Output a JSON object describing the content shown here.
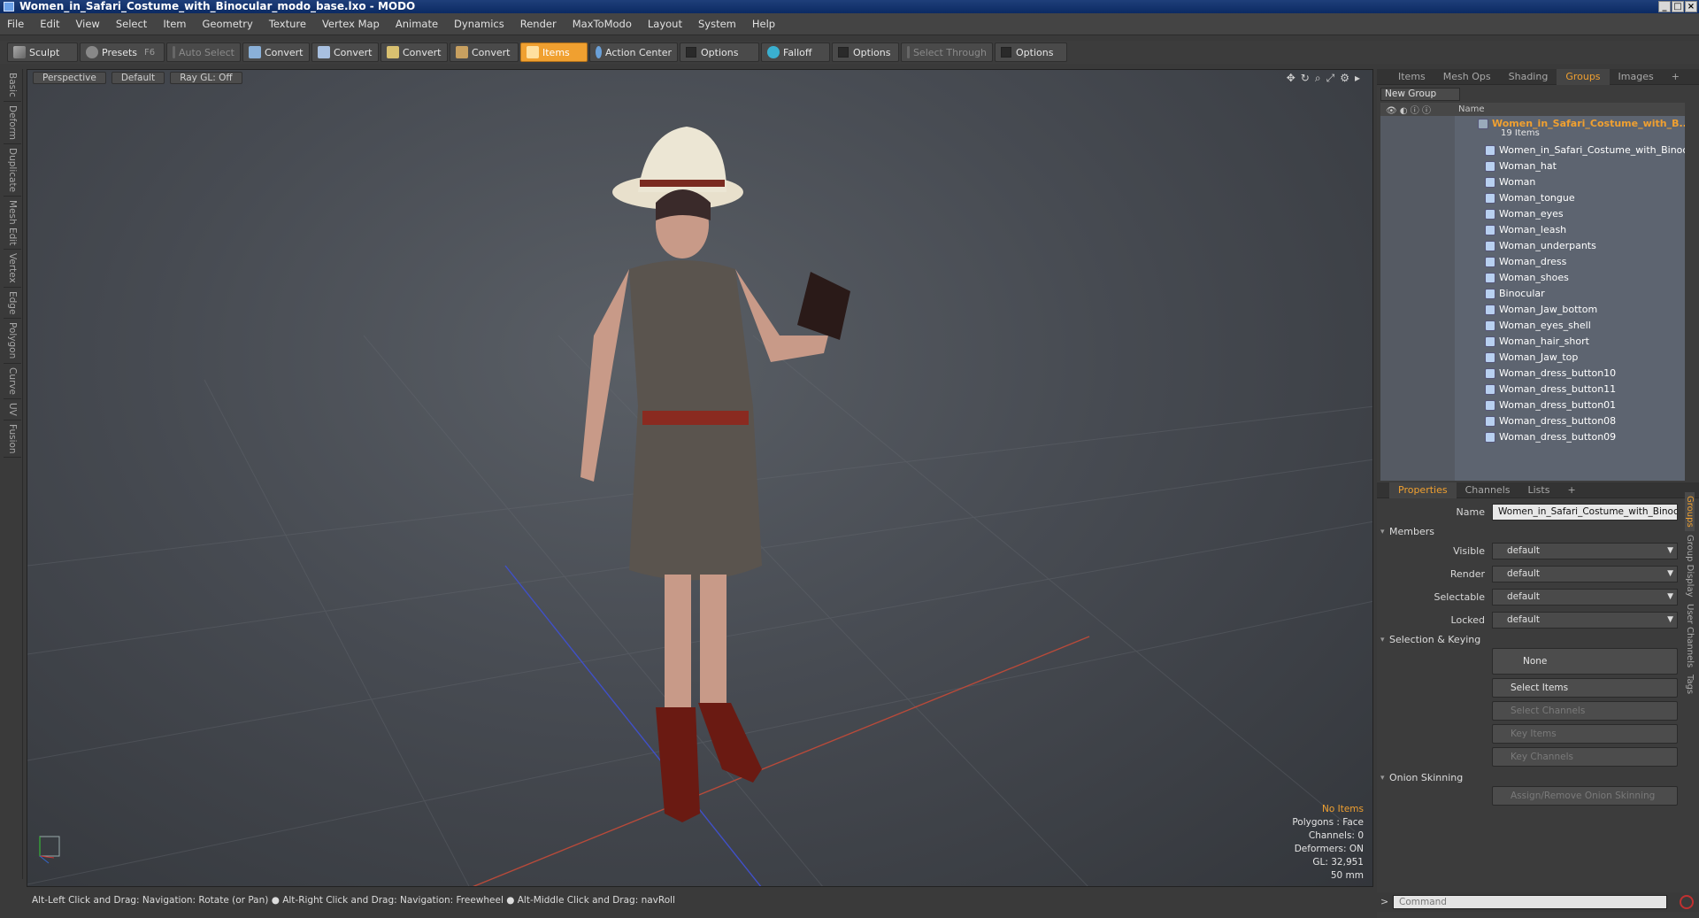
{
  "window": {
    "title": "Women_in_Safari_Costume_with_Binocular_modo_base.lxo - MODO"
  },
  "menu": [
    "File",
    "Edit",
    "View",
    "Select",
    "Item",
    "Geometry",
    "Texture",
    "Vertex Map",
    "Animate",
    "Dynamics",
    "Render",
    "MaxToModo",
    "Layout",
    "System",
    "Help"
  ],
  "toolbar": {
    "sculpt": "Sculpt",
    "presets": "Presets",
    "presets_key": "F6",
    "auto_select": "Auto Select",
    "convert": "Convert",
    "items": "Items",
    "action_center": "Action Center",
    "options": "Options",
    "falloff": "Falloff",
    "select_through": "Select Through"
  },
  "left_tabs": [
    "Basic",
    "Deform",
    "Duplicate",
    "Mesh Edit",
    "Vertex",
    "Edge",
    "Polygon",
    "Curve",
    "UV",
    "Fusion"
  ],
  "viewport": {
    "view": "Perspective",
    "shading": "Default",
    "raygl": "Ray GL: Off",
    "info": {
      "items": "No Items",
      "polygons": "Polygons : Face",
      "channels": "Channels: 0",
      "deformers": "Deformers: ON",
      "gl": "GL: 32,951",
      "scale": "50 mm"
    }
  },
  "status": "Alt-Left Click and Drag: Navigation: Rotate (or Pan) ● Alt-Right Click and Drag: Navigation: Freewheel ● Alt-Middle Click and Drag: navRoll",
  "right": {
    "tabs": [
      "Items",
      "Mesh Ops",
      "Shading",
      "Groups",
      "Images"
    ],
    "new_group": "New Group",
    "tree_col_name": "Name",
    "root": {
      "name": "Women_in_Safari_Costume_with_B...",
      "count": "19 Items"
    },
    "items": [
      "Women_in_Safari_Costume_with_Binoc...",
      "Woman_hat",
      "Woman",
      "Woman_tongue",
      "Woman_eyes",
      "Woman_leash",
      "Woman_underpants",
      "Woman_dress",
      "Woman_shoes",
      "Binocular",
      "Woman_Jaw_bottom",
      "Woman_eyes_shell",
      "Woman_hair_short",
      "Woman_Jaw_top",
      "Woman_dress_button10",
      "Woman_dress_button11",
      "Woman_dress_button01",
      "Woman_dress_button08",
      "Woman_dress_button09"
    ],
    "prop_tabs": [
      "Properties",
      "Channels",
      "Lists"
    ],
    "name_label": "Name",
    "name_value": "Women_in_Safari_Costume_with_Binocu",
    "members": "Members",
    "visible": {
      "label": "Visible",
      "value": "default"
    },
    "render": {
      "label": "Render",
      "value": "default"
    },
    "selectable": {
      "label": "Selectable",
      "value": "default"
    },
    "locked": {
      "label": "Locked",
      "value": "default"
    },
    "selection_keying": "Selection & Keying",
    "none": "None",
    "select_items": "Select Items",
    "select_channels": "Select Channels",
    "key_items": "Key Items",
    "key_channels": "Key Channels",
    "onion": "Onion Skinning",
    "assign_onion": "Assign/Remove Onion Skinning",
    "side_tabs": [
      "Groups",
      "Group Display",
      "User Channels",
      "Tags"
    ],
    "command_placeholder": "Command"
  }
}
